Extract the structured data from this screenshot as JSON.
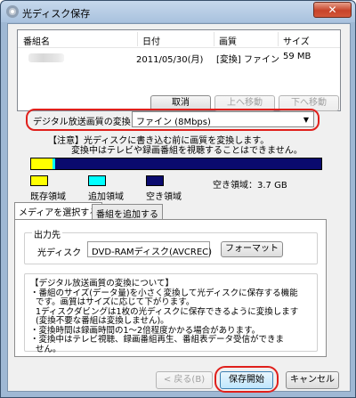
{
  "window": {
    "title": "光ディスク保存",
    "close_label": "✕"
  },
  "list": {
    "columns": [
      "番組名",
      "日付",
      "画質",
      "サイズ"
    ],
    "rows": [
      {
        "name": "",
        "date": "2011/05/30(月)",
        "quality": "[変換] ファイン",
        "size": "59 MB"
      }
    ]
  },
  "list_buttons": {
    "cancel": "取消",
    "move_up": "上へ移動",
    "move_down": "下へ移動"
  },
  "conversion": {
    "label": "デジタル放送画質の変換",
    "selected": "ファイン (8Mbps)",
    "note_line1": "【注意】光ディスクに書き込む前に画質を変換します。",
    "note_line2": "変換中はテレビや録画番組を視聴することはできません。"
  },
  "capacity": {
    "used_fraction": 0.075,
    "added_fraction": 0.01,
    "colors": {
      "used": "#ffff00",
      "added": "#00ffff",
      "free": "#0a0a6e"
    },
    "legend_used": "既存領域",
    "legend_added": "追加領域",
    "legend_free": "空き領域",
    "free_label": "空き領域：3.7 GB"
  },
  "tabs": {
    "select_media": "メディアを選択する",
    "add_program": "番組を追加する"
  },
  "output": {
    "group_label": "出力先",
    "drive_label": "光ディスク",
    "drive_value": "DVD-RAMディスク(AVCREC)",
    "format_button": "フォーマット"
  },
  "info": {
    "text": "【デジタル放送画質の変換について】\n・番組のサイズ(データ量)を小さく変換して光ディスクに保存する機能\n  です。画質はサイズに応じて下がります。\n  1ディスクダビングは1枚の光ディスクに保存できるように変換します\n  (変換不要な番組は変換しません)。\n・変換時間は録画時間の1〜2倍程度かかる場合があります。\n・変換中はテレビ視聴、録画番組再生、番組表データ受信ができま\n  せん。"
  },
  "footer": {
    "back": "< 戻る(B)",
    "start": "保存開始",
    "cancel": "キャンセル"
  },
  "accent_color": "#e0201c"
}
